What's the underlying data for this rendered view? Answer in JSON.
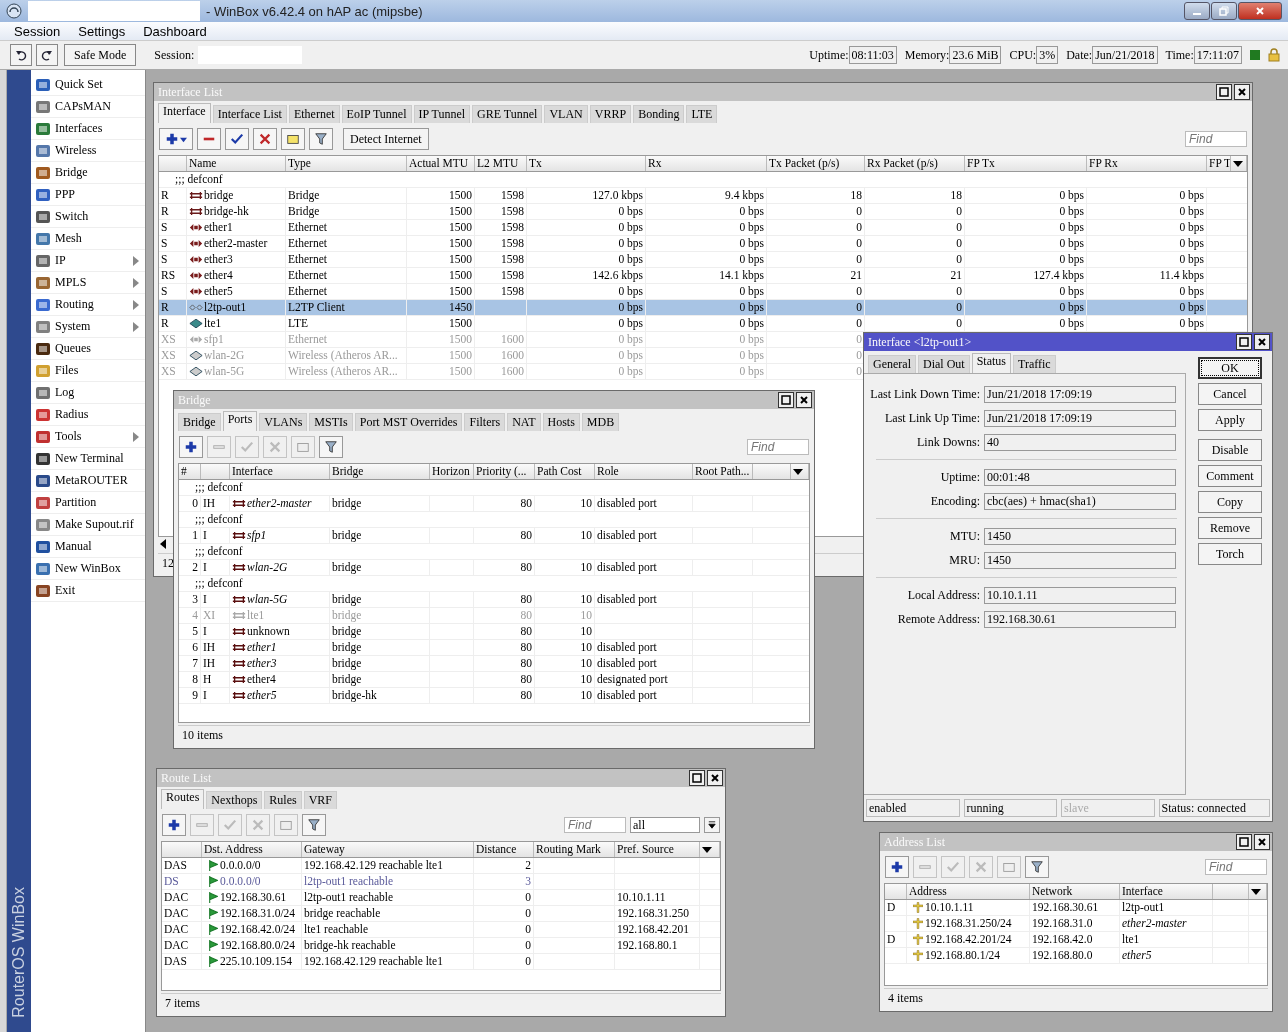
{
  "window": {
    "title": "- WinBox v6.42.4 on hAP ac (mipsbe)"
  },
  "menu": [
    {
      "label": "Session"
    },
    {
      "label": "Settings"
    },
    {
      "label": "Dashboard"
    }
  ],
  "toolbar": {
    "safe_mode": "Safe Mode",
    "session_label": "Session:",
    "stats": [
      {
        "label": "Uptime:",
        "value": "08:11:03"
      },
      {
        "label": "Memory:",
        "value": "23.6 MiB"
      },
      {
        "label": "CPU:",
        "value": "3%"
      },
      {
        "label": "Date:",
        "value": "Jun/21/2018"
      },
      {
        "label": "Time:",
        "value": "17:11:07"
      }
    ]
  },
  "sidebar": {
    "brand": "RouterOS WinBox",
    "items": [
      {
        "label": "Quick Set",
        "submenu": false
      },
      {
        "label": "CAPsMAN",
        "submenu": false
      },
      {
        "label": "Interfaces",
        "submenu": false
      },
      {
        "label": "Wireless",
        "submenu": false
      },
      {
        "label": "Bridge",
        "submenu": false
      },
      {
        "label": "PPP",
        "submenu": false
      },
      {
        "label": "Switch",
        "submenu": false
      },
      {
        "label": "Mesh",
        "submenu": false
      },
      {
        "label": "IP",
        "submenu": true
      },
      {
        "label": "MPLS",
        "submenu": true
      },
      {
        "label": "Routing",
        "submenu": true
      },
      {
        "label": "System",
        "submenu": true
      },
      {
        "label": "Queues",
        "submenu": false
      },
      {
        "label": "Files",
        "submenu": false
      },
      {
        "label": "Log",
        "submenu": false
      },
      {
        "label": "Radius",
        "submenu": false
      },
      {
        "label": "Tools",
        "submenu": true
      },
      {
        "label": "New Terminal",
        "submenu": false
      },
      {
        "label": "MetaROUTER",
        "submenu": false
      },
      {
        "label": "Partition",
        "submenu": false
      },
      {
        "label": "Make Supout.rif",
        "submenu": false
      },
      {
        "label": "Manual",
        "submenu": false
      },
      {
        "label": "New WinBox",
        "submenu": false
      },
      {
        "label": "Exit",
        "submenu": false
      }
    ]
  },
  "interface_list": {
    "title": "Interface List",
    "tabs": [
      {
        "label": "Interface",
        "selected": true
      },
      {
        "label": "Interface List",
        "selected": false
      },
      {
        "label": "Ethernet",
        "selected": false
      },
      {
        "label": "EoIP Tunnel",
        "selected": false
      },
      {
        "label": "IP Tunnel",
        "selected": false
      },
      {
        "label": "GRE Tunnel",
        "selected": false
      },
      {
        "label": "VLAN",
        "selected": false
      },
      {
        "label": "VRRP",
        "selected": false
      },
      {
        "label": "Bonding",
        "selected": false
      },
      {
        "label": "LTE",
        "selected": false
      }
    ],
    "tools": [
      {
        "kind": "add",
        "disabled": false,
        "menu": true
      },
      {
        "kind": "remove",
        "disabled": false,
        "menu": false
      },
      {
        "kind": "enable",
        "disabled": false,
        "menu": false
      },
      {
        "kind": "disable",
        "disabled": false,
        "menu": false
      },
      {
        "kind": "comment",
        "disabled": false,
        "menu": false
      },
      {
        "kind": "filter",
        "disabled": false,
        "menu": false
      }
    ],
    "detect_button": "Detect Internet",
    "find_placeholder": "Find",
    "columns": [
      "Name",
      "Type",
      "Actual MTU",
      "L2 MTU",
      "Tx",
      "Rx",
      "Tx Packet (p/s)",
      "Rx Packet (p/s)",
      "FP Tx",
      "FP Rx",
      "FP T"
    ],
    "rows": [
      {
        "kind": "comment",
        "text": ";;; defconf"
      },
      {
        "kind": "bridge",
        "flags": "R",
        "name": "bridge",
        "selected": false,
        "disabled": false,
        "cells": [
          "Bridge",
          "1500",
          "1598",
          "127.0 kbps",
          "9.4 kbps",
          "18",
          "18",
          "0 bps",
          "0 bps"
        ]
      },
      {
        "kind": "bridge",
        "flags": "R",
        "name": "bridge-hk",
        "selected": false,
        "disabled": false,
        "cells": [
          "Bridge",
          "1500",
          "1598",
          "0 bps",
          "0 bps",
          "0",
          "0",
          "0 bps",
          "0 bps"
        ]
      },
      {
        "kind": "ethernet",
        "flags": "S",
        "name": "ether1",
        "selected": false,
        "disabled": false,
        "cells": [
          "Ethernet",
          "1500",
          "1598",
          "0 bps",
          "0 bps",
          "0",
          "0",
          "0 bps",
          "0 bps"
        ]
      },
      {
        "kind": "ethernet",
        "flags": "S",
        "name": "ether2-master",
        "selected": false,
        "disabled": false,
        "cells": [
          "Ethernet",
          "1500",
          "1598",
          "0 bps",
          "0 bps",
          "0",
          "0",
          "0 bps",
          "0 bps"
        ]
      },
      {
        "kind": "ethernet",
        "flags": "S",
        "name": "ether3",
        "selected": false,
        "disabled": false,
        "cells": [
          "Ethernet",
          "1500",
          "1598",
          "0 bps",
          "0 bps",
          "0",
          "0",
          "0 bps",
          "0 bps"
        ]
      },
      {
        "kind": "ethernet",
        "flags": "RS",
        "name": "ether4",
        "selected": false,
        "disabled": false,
        "cells": [
          "Ethernet",
          "1500",
          "1598",
          "142.6 kbps",
          "14.1 kbps",
          "21",
          "21",
          "127.4 kbps",
          "11.4 kbps"
        ]
      },
      {
        "kind": "ethernet",
        "flags": "S",
        "name": "ether5",
        "selected": false,
        "disabled": false,
        "cells": [
          "Ethernet",
          "1500",
          "1598",
          "0 bps",
          "0 bps",
          "0",
          "0",
          "0 bps",
          "0 bps"
        ]
      },
      {
        "kind": "tunnel",
        "flags": "R",
        "name": "l2tp-out1",
        "selected": true,
        "disabled": false,
        "cells": [
          "L2TP Client",
          "1450",
          null,
          "0 bps",
          "0 bps",
          "0",
          "0",
          "0 bps",
          "0 bps"
        ]
      },
      {
        "kind": "lte",
        "flags": "R",
        "name": "lte1",
        "selected": false,
        "disabled": false,
        "cells": [
          "LTE",
          "1500",
          null,
          "0 bps",
          "0 bps",
          "0",
          "0",
          "0 bps",
          "0 bps"
        ]
      },
      {
        "kind": "ethernet",
        "flags": "XS",
        "name": "sfp1",
        "selected": false,
        "disabled": true,
        "cells": [
          "Ethernet",
          "1500",
          "1600",
          "0 bps",
          "0 bps",
          "0"
        ]
      },
      {
        "kind": "wireless",
        "flags": "XS",
        "name": "wlan-2G",
        "selected": false,
        "disabled": true,
        "cells": [
          "Wireless (Atheros AR...",
          "1500",
          "1600",
          "0 bps",
          "0 bps",
          "0"
        ]
      },
      {
        "kind": "wireless",
        "flags": "XS",
        "name": "wlan-5G",
        "selected": false,
        "disabled": true,
        "cells": [
          "Wireless (Atheros AR...",
          "1500",
          "1600",
          "0 bps",
          "0 bps",
          "0"
        ]
      }
    ],
    "status": "12"
  },
  "bridge": {
    "title": "Bridge",
    "tabs": [
      {
        "label": "Bridge",
        "selected": false
      },
      {
        "label": "Ports",
        "selected": true
      },
      {
        "label": "VLANs",
        "selected": false
      },
      {
        "label": "MSTIs",
        "selected": false
      },
      {
        "label": "Port MST Overrides",
        "selected": false
      },
      {
        "label": "Filters",
        "selected": false
      },
      {
        "label": "NAT",
        "selected": false
      },
      {
        "label": "Hosts",
        "selected": false
      },
      {
        "label": "MDB",
        "selected": false
      }
    ],
    "tools": [
      {
        "kind": "add",
        "disabled": false,
        "menu": false
      },
      {
        "kind": "remove",
        "disabled": true,
        "menu": false
      },
      {
        "kind": "enable",
        "disabled": true,
        "menu": false
      },
      {
        "kind": "disable",
        "disabled": true,
        "menu": false
      },
      {
        "kind": "comment",
        "disabled": true,
        "menu": false
      },
      {
        "kind": "filter",
        "disabled": false,
        "menu": false
      }
    ],
    "find_placeholder": "Find",
    "columns": [
      "#",
      "",
      "Interface",
      "Bridge",
      "Horizon",
      "Priority (...",
      "Path Cost",
      "Role",
      "Root Path..."
    ],
    "rows": [
      {
        "kind": "comment",
        "text": ";;; defconf"
      },
      {
        "kind": "port",
        "num": "0",
        "flags": "IH",
        "interface": "ether2-master",
        "inactive": true,
        "disabled": false,
        "bridge": "bridge",
        "priority": "80",
        "path_cost": "10",
        "role": "disabled port"
      },
      {
        "kind": "comment",
        "text": ";;; defconf"
      },
      {
        "kind": "port",
        "num": "1",
        "flags": "I",
        "interface": "sfp1",
        "inactive": true,
        "disabled": false,
        "bridge": "bridge",
        "priority": "80",
        "path_cost": "10",
        "role": "disabled port"
      },
      {
        "kind": "comment",
        "text": ";;; defconf"
      },
      {
        "kind": "port",
        "num": "2",
        "flags": "I",
        "interface": "wlan-2G",
        "inactive": true,
        "disabled": false,
        "bridge": "bridge",
        "priority": "80",
        "path_cost": "10",
        "role": "disabled port"
      },
      {
        "kind": "comment",
        "text": ";;; defconf"
      },
      {
        "kind": "port",
        "num": "3",
        "flags": "I",
        "interface": "wlan-5G",
        "inactive": true,
        "disabled": false,
        "bridge": "bridge",
        "priority": "80",
        "path_cost": "10",
        "role": "disabled port"
      },
      {
        "kind": "port",
        "num": "4",
        "flags": "XI",
        "interface": "lte1",
        "inactive": false,
        "disabled": true,
        "bridge": "bridge",
        "priority": "80",
        "path_cost": "10",
        "role": null
      },
      {
        "kind": "port",
        "num": "5",
        "flags": "I",
        "interface": "unknown",
        "inactive": false,
        "disabled": false,
        "bridge": "bridge",
        "priority": "80",
        "path_cost": "10",
        "role": null
      },
      {
        "kind": "port",
        "num": "6",
        "flags": "IH",
        "interface": "ether1",
        "inactive": true,
        "disabled": false,
        "bridge": "bridge",
        "priority": "80",
        "path_cost": "10",
        "role": "disabled port"
      },
      {
        "kind": "port",
        "num": "7",
        "flags": "IH",
        "interface": "ether3",
        "inactive": true,
        "disabled": false,
        "bridge": "bridge",
        "priority": "80",
        "path_cost": "10",
        "role": "disabled port"
      },
      {
        "kind": "port",
        "num": "8",
        "flags": "H",
        "interface": "ether4",
        "inactive": false,
        "disabled": false,
        "bridge": "bridge",
        "priority": "80",
        "path_cost": "10",
        "role": "designated port"
      },
      {
        "kind": "port",
        "num": "9",
        "flags": "I",
        "interface": "ether5",
        "inactive": true,
        "disabled": false,
        "bridge": "bridge-hk",
        "priority": "80",
        "path_cost": "10",
        "role": "disabled port"
      }
    ],
    "status": "10 items"
  },
  "interface_dialog": {
    "title": "Interface <l2tp-out1>",
    "tabs": [
      {
        "label": "General",
        "selected": false
      },
      {
        "label": "Dial Out",
        "selected": false
      },
      {
        "label": "Status",
        "selected": true
      },
      {
        "label": "Traffic",
        "selected": false
      }
    ],
    "groups": [
      [
        {
          "label": "Last Link Down Time:",
          "value": "Jun/21/2018 17:09:19"
        },
        {
          "label": "Last Link Up Time:",
          "value": "Jun/21/2018 17:09:19"
        },
        {
          "label": "Link Downs:",
          "value": "40"
        }
      ],
      [
        {
          "label": "Uptime:",
          "value": "00:01:48"
        },
        {
          "label": "Encoding:",
          "value": "cbc(aes) + hmac(sha1)"
        }
      ],
      [
        {
          "label": "MTU:",
          "value": "1450"
        },
        {
          "label": "MRU:",
          "value": "1450"
        }
      ],
      [
        {
          "label": "Local Address:",
          "value": "10.10.1.11"
        },
        {
          "label": "Remote Address:",
          "value": "192.168.30.61"
        }
      ]
    ],
    "button_groups": [
      [
        {
          "label": "OK",
          "focused": true
        },
        {
          "label": "Cancel",
          "focused": false
        },
        {
          "label": "Apply",
          "focused": false
        }
      ],
      [
        {
          "label": "Disable",
          "focused": false
        },
        {
          "label": "Comment",
          "focused": false
        },
        {
          "label": "Copy",
          "focused": false
        },
        {
          "label": "Remove",
          "focused": false
        },
        {
          "label": "Torch",
          "focused": false
        }
      ]
    ],
    "status": [
      {
        "text": "enabled",
        "disabled": false
      },
      {
        "text": "running",
        "disabled": false
      },
      {
        "text": "slave",
        "disabled": true
      },
      {
        "text": "Status: connected",
        "disabled": false
      }
    ]
  },
  "route_list": {
    "title": "Route List",
    "tabs": [
      {
        "label": "Routes",
        "selected": true
      },
      {
        "label": "Nexthops",
        "selected": false
      },
      {
        "label": "Rules",
        "selected": false
      },
      {
        "label": "VRF",
        "selected": false
      }
    ],
    "tools": [
      {
        "kind": "add",
        "disabled": false,
        "menu": false
      },
      {
        "kind": "remove",
        "disabled": true,
        "menu": false
      },
      {
        "kind": "enable",
        "disabled": true,
        "menu": false
      },
      {
        "kind": "disable",
        "disabled": true,
        "menu": false
      },
      {
        "kind": "comment",
        "disabled": true,
        "menu": false
      },
      {
        "kind": "filter",
        "disabled": false,
        "menu": false
      }
    ],
    "find_placeholder": "Find",
    "scope": "all",
    "columns": [
      "",
      "Dst. Address",
      "Gateway",
      "Distance",
      "Routing Mark",
      "Pref. Source"
    ],
    "rows": [
      {
        "flags": "DAS",
        "dst": "0.0.0.0/0",
        "gateway": "192.168.42.129 reachable lte1",
        "distance": "2",
        "pref_source": null,
        "inactive": false
      },
      {
        "flags": "DS",
        "dst": "0.0.0.0/0",
        "gateway": "l2tp-out1 reachable",
        "distance": "3",
        "pref_source": null,
        "inactive": true
      },
      {
        "flags": "DAC",
        "dst": "192.168.30.61",
        "gateway": "l2tp-out1 reachable",
        "distance": "0",
        "pref_source": "10.10.1.11",
        "inactive": false
      },
      {
        "flags": "DAC",
        "dst": "192.168.31.0/24",
        "gateway": "bridge reachable",
        "distance": "0",
        "pref_source": "192.168.31.250",
        "inactive": false
      },
      {
        "flags": "DAC",
        "dst": "192.168.42.0/24",
        "gateway": "lte1 reachable",
        "distance": "0",
        "pref_source": "192.168.42.201",
        "inactive": false
      },
      {
        "flags": "DAC",
        "dst": "192.168.80.0/24",
        "gateway": "bridge-hk reachable",
        "distance": "0",
        "pref_source": "192.168.80.1",
        "inactive": false
      },
      {
        "flags": "DAS",
        "dst": "225.10.109.154",
        "gateway": "192.168.42.129 reachable lte1",
        "distance": "0",
        "pref_source": null,
        "inactive": false
      }
    ],
    "status": "7 items"
  },
  "address_list": {
    "title": "Address List",
    "tools": [
      {
        "kind": "add",
        "disabled": false,
        "menu": false
      },
      {
        "kind": "remove",
        "disabled": true,
        "menu": false
      },
      {
        "kind": "enable",
        "disabled": true,
        "menu": false
      },
      {
        "kind": "disable",
        "disabled": true,
        "menu": false
      },
      {
        "kind": "comment",
        "disabled": true,
        "menu": false
      },
      {
        "kind": "filter",
        "disabled": false,
        "menu": false
      }
    ],
    "find_placeholder": "Find",
    "columns": [
      "",
      "Address",
      "Network",
      "Interface"
    ],
    "rows": [
      {
        "flags": "D",
        "address": "10.10.1.11",
        "network": "192.168.30.61",
        "interface": "l2tp-out1",
        "inactive": false
      },
      {
        "flags": null,
        "address": "192.168.31.250/24",
        "network": "192.168.31.0",
        "interface": "ether2-master",
        "inactive": true
      },
      {
        "flags": "D",
        "address": "192.168.42.201/24",
        "network": "192.168.42.0",
        "interface": "lte1",
        "inactive": false
      },
      {
        "flags": null,
        "address": "192.168.80.1/24",
        "network": "192.168.80.0",
        "interface": "ether5",
        "inactive": true
      }
    ],
    "status": "4 items"
  }
}
